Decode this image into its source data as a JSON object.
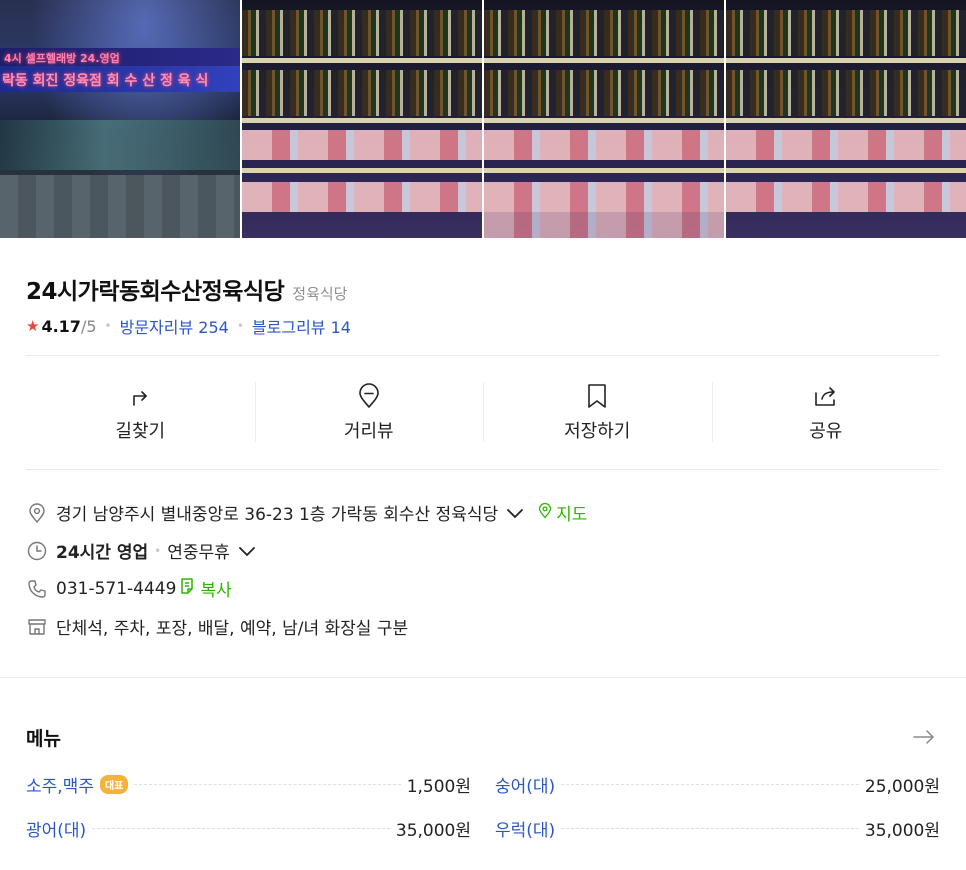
{
  "place": {
    "name": "24시가락동회수산정육식당",
    "category": "정육식당",
    "rating": {
      "star_icon": "star-icon",
      "score": "4.17",
      "max": "/5",
      "visitor_reviews": "방문자리뷰 254",
      "blog_reviews": "블로그리뷰 14"
    }
  },
  "photos": {
    "sign_line1": "4시 셀프헬래방  24.영업",
    "sign_line2": "락동 회진 정육점 회 수 산 정 육 식"
  },
  "actions": [
    {
      "label": "길찾기",
      "icon": "directions-icon"
    },
    {
      "label": "거리뷰",
      "icon": "street-view-icon"
    },
    {
      "label": "저장하기",
      "icon": "bookmark-icon"
    },
    {
      "label": "공유",
      "icon": "share-icon"
    }
  ],
  "info": {
    "address": "경기 남양주시 별내중앙로 36-23 1층 가락동 회수산 정육식당",
    "map_link": "지도",
    "hours": "24시간 영업",
    "holiday": "연중무휴",
    "phone": "031-571-4449",
    "copy_link": "복사",
    "amenities": "단체석, 주차, 포장, 배달, 예약, 남/녀 화장실 구분"
  },
  "menu": {
    "title": "메뉴",
    "items": [
      {
        "name": "소주,맥주",
        "badge": "대표",
        "price": "1,500원"
      },
      {
        "name": "숭어(대)",
        "price": "25,000원"
      },
      {
        "name": "광어(대)",
        "price": "35,000원"
      },
      {
        "name": "우럭(대)",
        "price": "35,000원"
      }
    ]
  },
  "colors": {
    "link_blue": "#2b56c6",
    "map_green": "#2db400",
    "star_red": "#e8473d",
    "badge_orange": "#f6b33b"
  }
}
